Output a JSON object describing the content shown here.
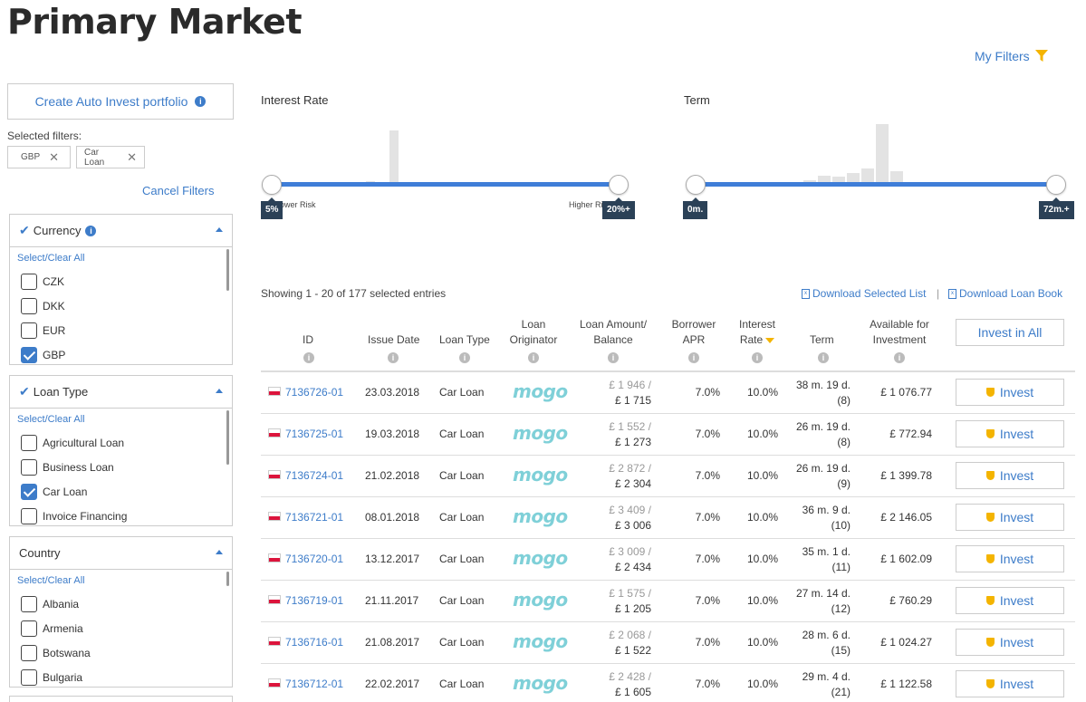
{
  "page_title": "Primary Market",
  "my_filters": "My Filters",
  "sidebar": {
    "auto_invest_button": "Create Auto Invest portfolio",
    "selected_filters_label": "Selected filters:",
    "chips": [
      "GBP",
      "Car Loan"
    ],
    "cancel_filters": "Cancel Filters",
    "panels": [
      {
        "title": "Currency",
        "checked": true,
        "info": true,
        "select_all": "Select/Clear All",
        "options": [
          {
            "label": "CZK",
            "checked": false
          },
          {
            "label": "DKK",
            "checked": false
          },
          {
            "label": "EUR",
            "checked": false
          },
          {
            "label": "GBP",
            "checked": true
          }
        ]
      },
      {
        "title": "Loan Type",
        "checked": true,
        "info": false,
        "select_all": "Select/Clear All",
        "options": [
          {
            "label": "Agricultural Loan",
            "checked": false
          },
          {
            "label": "Business Loan",
            "checked": false
          },
          {
            "label": "Car Loan",
            "checked": true
          },
          {
            "label": "Invoice Financing",
            "checked": false
          }
        ]
      },
      {
        "title": "Country",
        "checked": false,
        "info": false,
        "select_all": "Select/Clear All",
        "options": [
          {
            "label": "Albania",
            "checked": false
          },
          {
            "label": "Armenia",
            "checked": false
          },
          {
            "label": "Botswana",
            "checked": false
          },
          {
            "label": "Bulgaria",
            "checked": false
          }
        ]
      }
    ]
  },
  "sliders": {
    "interest": {
      "title": "Interest Rate",
      "min_label": "5%",
      "max_label": "20%+",
      "low_text": "Lower Risk",
      "high_text": "Higher Risk"
    },
    "term": {
      "title": "Term",
      "min_label": "0m.",
      "max_label": "72m.+"
    }
  },
  "table": {
    "showing": "Showing 1 - 20 of 177 selected entries",
    "download_selected": "Download Selected List",
    "download_book": "Download Loan Book",
    "separator": "|",
    "headers": {
      "id": "ID",
      "issue_date": "Issue Date",
      "loan_type": "Loan Type",
      "originator_1": "Loan",
      "originator_2": "Originator",
      "amount_1": "Loan Amount/",
      "amount_2": "Balance",
      "apr_1": "Borrower",
      "apr_2": "APR",
      "rate_1": "Interest",
      "rate_2": "Rate",
      "term": "Term",
      "avail_1": "Available for",
      "avail_2": "Investment"
    },
    "invest_all": "Invest in All",
    "invest_label": "Invest",
    "originator_logo": "mogo",
    "rows": [
      {
        "id": "7136726-01",
        "date": "23.03.2018",
        "type": "Car Loan",
        "amount": "£ 1 946 /",
        "balance": "£ 1 715",
        "apr": "7.0%",
        "rate": "10.0%",
        "term": "38 m. 19 d.",
        "term_sub": "(8)",
        "available": "£ 1 076.77"
      },
      {
        "id": "7136725-01",
        "date": "19.03.2018",
        "type": "Car Loan",
        "amount": "£ 1 552 /",
        "balance": "£ 1 273",
        "apr": "7.0%",
        "rate": "10.0%",
        "term": "26 m. 19 d.",
        "term_sub": "(8)",
        "available": "£ 772.94"
      },
      {
        "id": "7136724-01",
        "date": "21.02.2018",
        "type": "Car Loan",
        "amount": "£ 2 872 /",
        "balance": "£ 2 304",
        "apr": "7.0%",
        "rate": "10.0%",
        "term": "26 m. 19 d.",
        "term_sub": "(9)",
        "available": "£ 1 399.78"
      },
      {
        "id": "7136721-01",
        "date": "08.01.2018",
        "type": "Car Loan",
        "amount": "£ 3 409 /",
        "balance": "£ 3 006",
        "apr": "7.0%",
        "rate": "10.0%",
        "term": "36 m. 9 d.",
        "term_sub": "(10)",
        "available": "£ 2 146.05"
      },
      {
        "id": "7136720-01",
        "date": "13.12.2017",
        "type": "Car Loan",
        "amount": "£ 3 009 /",
        "balance": "£ 2 434",
        "apr": "7.0%",
        "rate": "10.0%",
        "term": "35 m. 1 d.",
        "term_sub": "(11)",
        "available": "£ 1 602.09"
      },
      {
        "id": "7136719-01",
        "date": "21.11.2017",
        "type": "Car Loan",
        "amount": "£ 1 575 /",
        "balance": "£ 1 205",
        "apr": "7.0%",
        "rate": "10.0%",
        "term": "27 m. 14 d.",
        "term_sub": "(12)",
        "available": "£ 760.29"
      },
      {
        "id": "7136716-01",
        "date": "21.08.2017",
        "type": "Car Loan",
        "amount": "£ 2 068 /",
        "balance": "£ 1 522",
        "apr": "7.0%",
        "rate": "10.0%",
        "term": "28 m. 6 d.",
        "term_sub": "(15)",
        "available": "£ 1 024.27"
      },
      {
        "id": "7136712-01",
        "date": "22.02.2017",
        "type": "Car Loan",
        "amount": "£ 2 428 /",
        "balance": "£ 1 605",
        "apr": "7.0%",
        "rate": "10.0%",
        "term": "29 m. 4 d.",
        "term_sub": "(21)",
        "available": "£ 1 122.58"
      }
    ]
  },
  "colors": {
    "accent": "#3d7cc9",
    "track": "#3f7ed8",
    "tag_bg": "#2b4157",
    "invest_icon": "#f4b400",
    "logo": "#7fd0d8"
  }
}
